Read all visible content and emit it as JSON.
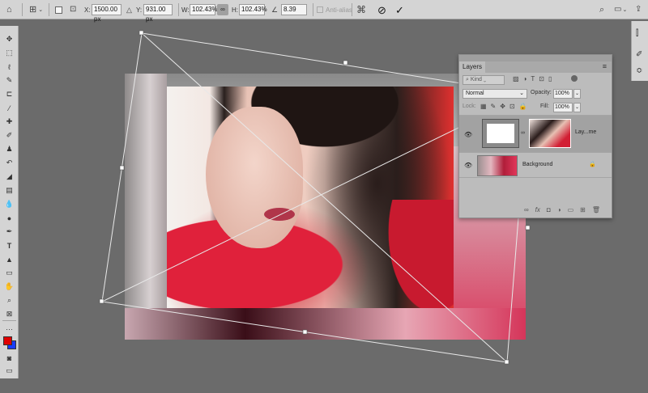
{
  "options_bar": {
    "home_icon": "home-icon",
    "reference_point_icon": "reference-point-icon",
    "x_label": "X:",
    "x_value": "1500.00 px",
    "y_label": "Y:",
    "y_value": "931.00 px",
    "w_label": "W:",
    "w_value": "102.43%",
    "link_icon": "link-icon",
    "h_label": "H:",
    "h_value": "102.43%",
    "angle_icon": "angle-icon",
    "angle_value": "8.39",
    "antialias_label": "Anti-alias",
    "warp_icon": "warp-icon",
    "cancel_icon": "cancel-icon",
    "commit_icon": "commit-icon",
    "search_icon": "search-icon",
    "workspace_icon": "workspace-icon",
    "share_icon": "share-icon"
  },
  "layers_panel": {
    "title": "Layers",
    "filter_kind": "Kind",
    "blend_mode": "Normal",
    "opacity_label": "Opacity:",
    "opacity_value": "100%",
    "lock_label": "Lock:",
    "fill_label": "Fill:",
    "fill_value": "100%",
    "layers": [
      {
        "name": "Lay...me",
        "visible": true,
        "selected": true
      },
      {
        "name": "Background",
        "visible": true,
        "locked": true
      }
    ]
  },
  "colors": {
    "foreground": "#e00000",
    "background": "#1a3cff"
  }
}
